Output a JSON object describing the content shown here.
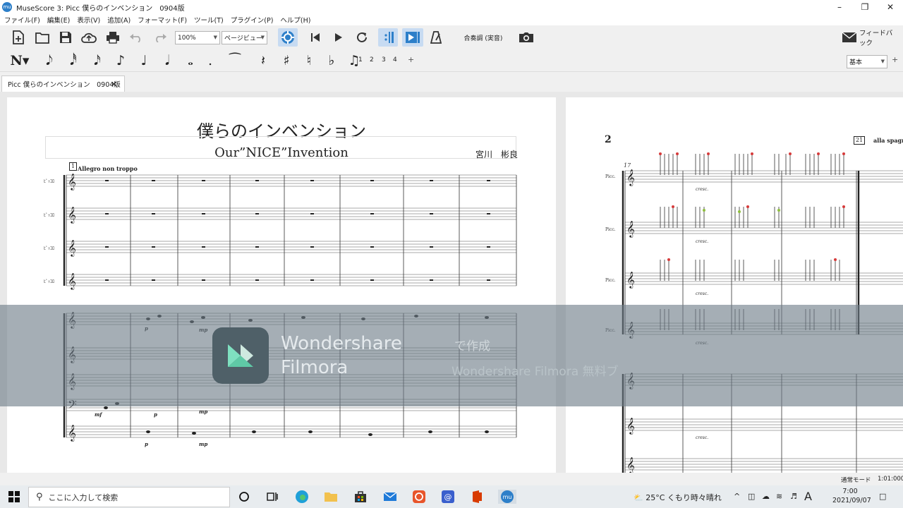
{
  "window": {
    "title": "MuseScore 3: Picc 僕らのインベンション　0904版",
    "app_icon": "mu"
  },
  "menu": [
    "ファイル(F)",
    "編集(E)",
    "表示(V)",
    "追加(A)",
    "フォーマット(F)",
    "ツール(T)",
    "プラグイン(P)",
    "ヘルプ(H)"
  ],
  "toolbar": {
    "zoom": "100%",
    "view_mode": "ページビュー",
    "concert_pitch": "合奏調 (実音)",
    "feedback": "フィードバック",
    "workspace": "基本",
    "voices": [
      "1",
      "2",
      "3",
      "4"
    ]
  },
  "tab": {
    "label": "Picc 僕らのインベンション　0904版"
  },
  "score": {
    "title": "僕らのインベンション",
    "subtitle": "Our”NICE”Invention",
    "composer": "宮川　彬良",
    "tempo": "Allegro non troppo",
    "rehearsal_1": "1",
    "page_number": "2",
    "rehearsal_21": "21",
    "measure_number": "17",
    "section_marking": "alla spagn",
    "instrument_short": "ﾋﾟｯｺﾛ",
    "instrument_p2": "Picc."
  },
  "watermark": {
    "brand_line1": "Wondershare",
    "brand_line2": "Filmora",
    "made_with": "で作成",
    "free_version": "Wondershare Filmora 無料ブ"
  },
  "status": {
    "mode": "通常モード",
    "time": "1:01:000"
  },
  "taskbar": {
    "search_placeholder": "ここに入力して検索",
    "weather": "25°C  くもり時々晴れ",
    "ime": "A",
    "clock_time": "7:00",
    "clock_date": "2021/09/07"
  },
  "colors": {
    "accent": "#2d7fc9",
    "active_button": "#c7dbf2",
    "watermark_band": "#6e7d87"
  }
}
